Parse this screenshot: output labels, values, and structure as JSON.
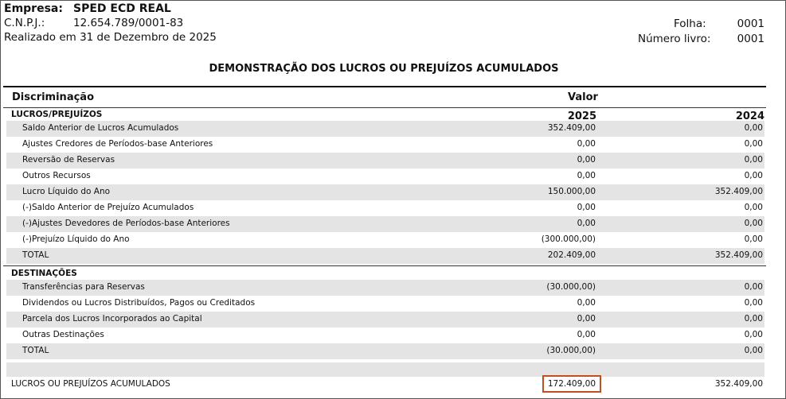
{
  "header": {
    "empresa_label": "Empresa:",
    "empresa_value": "SPED ECD REAL",
    "cnpj_label": "C.N.P.J.:",
    "cnpj_value": "12.654.789/0001-83",
    "realizado": "Realizado em 31 de Dezembro de 2025",
    "folha_label": "Folha:",
    "folha_value": "0001",
    "livro_label": "Número livro:",
    "livro_value": "0001"
  },
  "title": "DEMONSTRAÇÃO DOS LUCROS OU PREJUÍZOS ACUMULADOS",
  "columns": {
    "discriminacao": "Discriminação",
    "valor": "Valor",
    "year1": "2025",
    "year2": "2024"
  },
  "section1": {
    "title": "LUCROS/PREJUÍZOS",
    "rows": [
      {
        "label": "Saldo Anterior de Lucros Acumulados",
        "v2025": "352.409,00",
        "v2024": "0,00"
      },
      {
        "label": "Ajustes Credores de Períodos-base Anteriores",
        "v2025": "0,00",
        "v2024": "0,00"
      },
      {
        "label": "Reversão de Reservas",
        "v2025": "0,00",
        "v2024": "0,00"
      },
      {
        "label": "Outros Recursos",
        "v2025": "0,00",
        "v2024": "0,00"
      },
      {
        "label": "Lucro Líquido do Ano",
        "v2025": "150.000,00",
        "v2024": "352.409,00"
      },
      {
        "label": "(-)Saldo Anterior de Prejuízo Acumulados",
        "v2025": "0,00",
        "v2024": "0,00"
      },
      {
        "label": "(-)Ajustes Devedores de Períodos-base Anteriores",
        "v2025": "0,00",
        "v2024": "0,00"
      },
      {
        "label": "(-)Prejuízo Líquido do Ano",
        "v2025": "(300.000,00)",
        "v2024": "0,00"
      },
      {
        "label": "TOTAL",
        "v2025": "202.409,00",
        "v2024": "352.409,00"
      }
    ]
  },
  "section2": {
    "title": "DESTINAÇÕES",
    "rows": [
      {
        "label": "Transferências para Reservas",
        "v2025": "(30.000,00)",
        "v2024": "0,00"
      },
      {
        "label": "Dividendos ou Lucros Distribuídos, Pagos ou Creditados",
        "v2025": "0,00",
        "v2024": "0,00"
      },
      {
        "label": "Parcela dos Lucros Incorporados ao Capital",
        "v2025": "0,00",
        "v2024": "0,00"
      },
      {
        "label": "Outras Destinações",
        "v2025": "0,00",
        "v2024": "0,00"
      },
      {
        "label": "TOTAL",
        "v2025": "(30.000,00)",
        "v2024": "0,00"
      }
    ]
  },
  "final": {
    "label": "LUCROS OU PREJUÍZOS ACUMULADOS",
    "v2025": "172.409,00",
    "v2024": "352.409,00"
  }
}
